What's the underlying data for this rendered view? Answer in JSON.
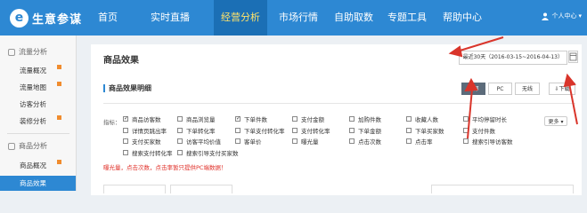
{
  "header": {
    "logo_glyph": "e",
    "logo_text": "生意参谋",
    "nav": [
      "首页",
      "实时直播",
      "经营分析",
      "市场行情",
      "自助取数",
      "专题工具",
      "帮助中心"
    ],
    "active_nav": "经营分析",
    "user_label": "个人中心"
  },
  "sidebar": {
    "section1": "流量分析",
    "items1": [
      "流量概况",
      "流量地图",
      "访客分析",
      "装修分析"
    ],
    "section2": "商品分析",
    "items2": [
      "商品概况",
      "商品效果"
    ],
    "active_item": "商品效果"
  },
  "main": {
    "title": "商品效果",
    "date_range": "最近30天（2016-03-15~2016-04-13）",
    "section_title": "商品效果明细",
    "segments": [
      "全部",
      "PC",
      "无线"
    ],
    "active_segment": "全部",
    "download": "下载",
    "indicators_label": "指标：",
    "more": "更多",
    "note": "曝光量，点击次数，点击率暂只提供PC端数据！"
  },
  "options": [
    {
      "label": "商品访客数",
      "checked": true
    },
    {
      "label": "商品浏览量",
      "checked": false
    },
    {
      "label": "下单件数",
      "checked": true
    },
    {
      "label": "支付金额",
      "checked": false
    },
    {
      "label": "加购件数",
      "checked": false
    },
    {
      "label": "收藏人数",
      "checked": false
    },
    {
      "label": "平均停留时长",
      "checked": false
    },
    {
      "label": "详情页跳出率",
      "checked": false
    },
    {
      "label": "下单转化率",
      "checked": false
    },
    {
      "label": "下单支付转化率",
      "checked": false
    },
    {
      "label": "支付转化率",
      "checked": false
    },
    {
      "label": "下单金额",
      "checked": false
    },
    {
      "label": "下单买家数",
      "checked": false
    },
    {
      "label": "支付件数",
      "checked": false
    },
    {
      "label": "支付买家数",
      "checked": false
    },
    {
      "label": "访客平均价值",
      "checked": false
    },
    {
      "label": "客单价",
      "checked": false
    },
    {
      "label": "曝光量",
      "checked": false
    },
    {
      "label": "点击次数",
      "checked": false
    },
    {
      "label": "点击率",
      "checked": false
    },
    {
      "label": "搜索引导访客数",
      "checked": false
    },
    {
      "label": "搜索支付转化率",
      "checked": false
    },
    {
      "label": "搜索引导支付买家数",
      "checked": false
    }
  ],
  "colors": {
    "brand": "#2d88d3",
    "active_nav_bg": "#1b6fb5",
    "active_nav_text": "#ffe36a",
    "note": "#e0312a",
    "badge": "#f08c2e",
    "annotation_arrow": "#d9352b"
  }
}
